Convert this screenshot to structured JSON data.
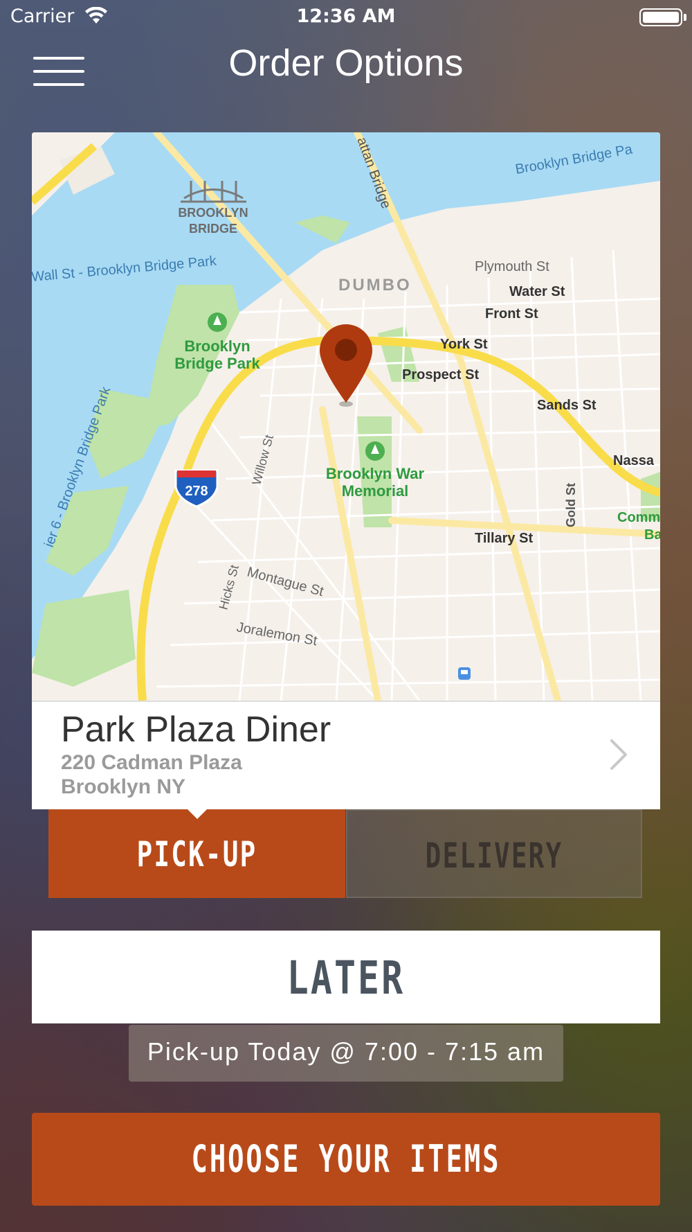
{
  "status_bar": {
    "carrier": "Carrier",
    "time": "12:36 AM"
  },
  "header": {
    "title": "Order Options"
  },
  "map": {
    "labels": {
      "brooklyn_bridge": [
        "BROOKLYN",
        "BRIDGE"
      ],
      "manhattan_bridge": "attan Bridge",
      "brooklyn_bridge_park_top": "Brooklyn Bridge Pa",
      "wall_st": "Wall St - Brooklyn Bridge Park",
      "dumbo": "DUMBO",
      "plymouth_st": "Plymouth St",
      "water_st": "Water St",
      "front_st": "Front St",
      "york_st": "York St",
      "prospect_st": "Prospect St",
      "sands_st": "Sands St",
      "nassau": "Nassa",
      "park": [
        "Brooklyn",
        "Bridge Park"
      ],
      "pier6": "ier 6 - Brooklyn Bridge Park",
      "brooklyn_bridge_park_left": "Brooklyn Bridge Park",
      "willow_st": "Willow St",
      "war_memorial": [
        "Brooklyn War",
        "Memorial"
      ],
      "interstate": "278",
      "gold_st": "Gold St",
      "tillary_st": "Tillary St",
      "hicks_st": "Hicks St",
      "montague_st": "Montague St",
      "joralemon_st": "Joralemon St",
      "comm": [
        "Comm",
        "Ba"
      ]
    }
  },
  "location": {
    "name": "Park Plaza Diner",
    "address_line1": "220 Cadman Plaza",
    "address_line2": "Brooklyn NY"
  },
  "tabs": {
    "pickup": "PICK-UP",
    "delivery": "DELIVERY",
    "selected": "pickup"
  },
  "time_option": {
    "label": "LATER"
  },
  "schedule": {
    "text": "Pick-up Today @ 7:00 - 7:15 am"
  },
  "cta": {
    "label": "CHOOSE YOUR ITEMS"
  },
  "colors": {
    "accent": "#b84a1a",
    "water": "#a8daf4",
    "park": "#bfe3a8",
    "highway": "#f9dc4a",
    "pin": "#b03a10"
  }
}
